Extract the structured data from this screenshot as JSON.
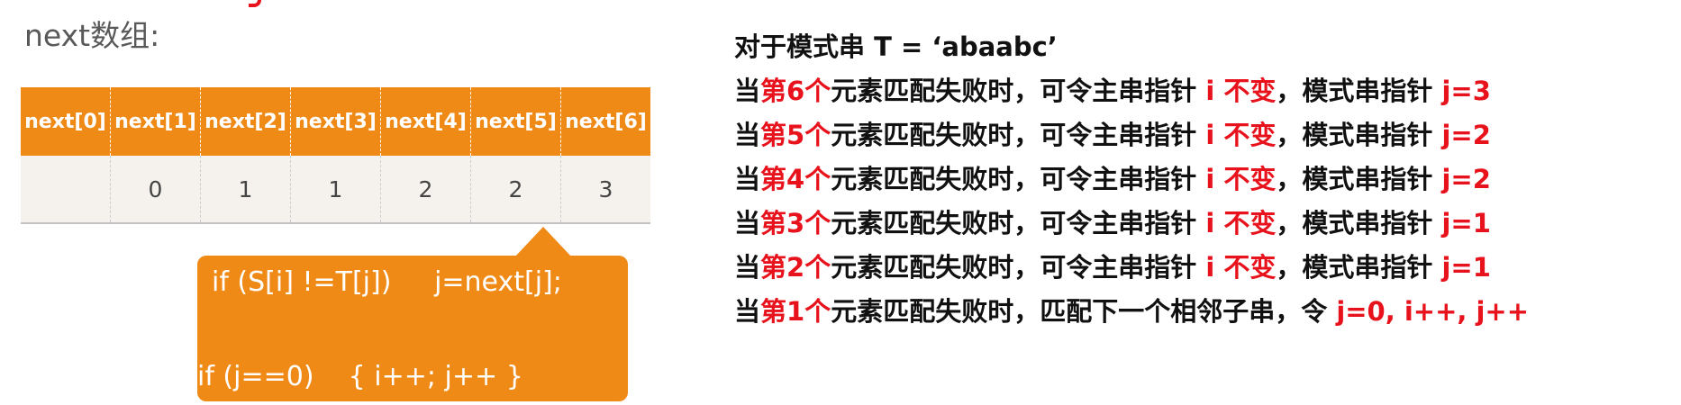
{
  "title": "next数组:",
  "next_table": {
    "headers": [
      "next[0]",
      "next[1]",
      "next[2]",
      "next[3]",
      "next[4]",
      "next[5]",
      "next[6]"
    ],
    "values": [
      "",
      "0",
      "1",
      "1",
      "2",
      "2",
      "3"
    ]
  },
  "callout": {
    "line1": "if (S[i] !=T[j])     j=next[j];",
    "line2": "if (j==0)    { i++; j++ }"
  },
  "rules": {
    "heading": "对于模式串 T = ‘abaabc’",
    "lines": [
      {
        "prefix": "当",
        "ord": "第6个",
        "mid": "元素匹配失败时，可令主串指针 ",
        "keep": "i 不变",
        "sep": "，模式串指针 ",
        "result": "j=3"
      },
      {
        "prefix": "当",
        "ord": "第5个",
        "mid": "元素匹配失败时，可令主串指针 ",
        "keep": "i 不变",
        "sep": "，模式串指针 ",
        "result": "j=2"
      },
      {
        "prefix": "当",
        "ord": "第4个",
        "mid": "元素匹配失败时，可令主串指针 ",
        "keep": "i 不变",
        "sep": "，模式串指针 ",
        "result": "j=2"
      },
      {
        "prefix": "当",
        "ord": "第3个",
        "mid": "元素匹配失败时，可令主串指针 ",
        "keep": "i 不变",
        "sep": "，模式串指针 ",
        "result": "j=1"
      },
      {
        "prefix": "当",
        "ord": "第2个",
        "mid": "元素匹配失败时，可令主串指针 ",
        "keep": "i 不变",
        "sep": "，模式串指针 ",
        "result": "j=1"
      }
    ],
    "last_line": {
      "prefix": "当",
      "ord": "第1个",
      "mid": "元素匹配失败时，匹配下一个相邻子串，令 ",
      "result": "j=0, i++, j++"
    }
  }
}
